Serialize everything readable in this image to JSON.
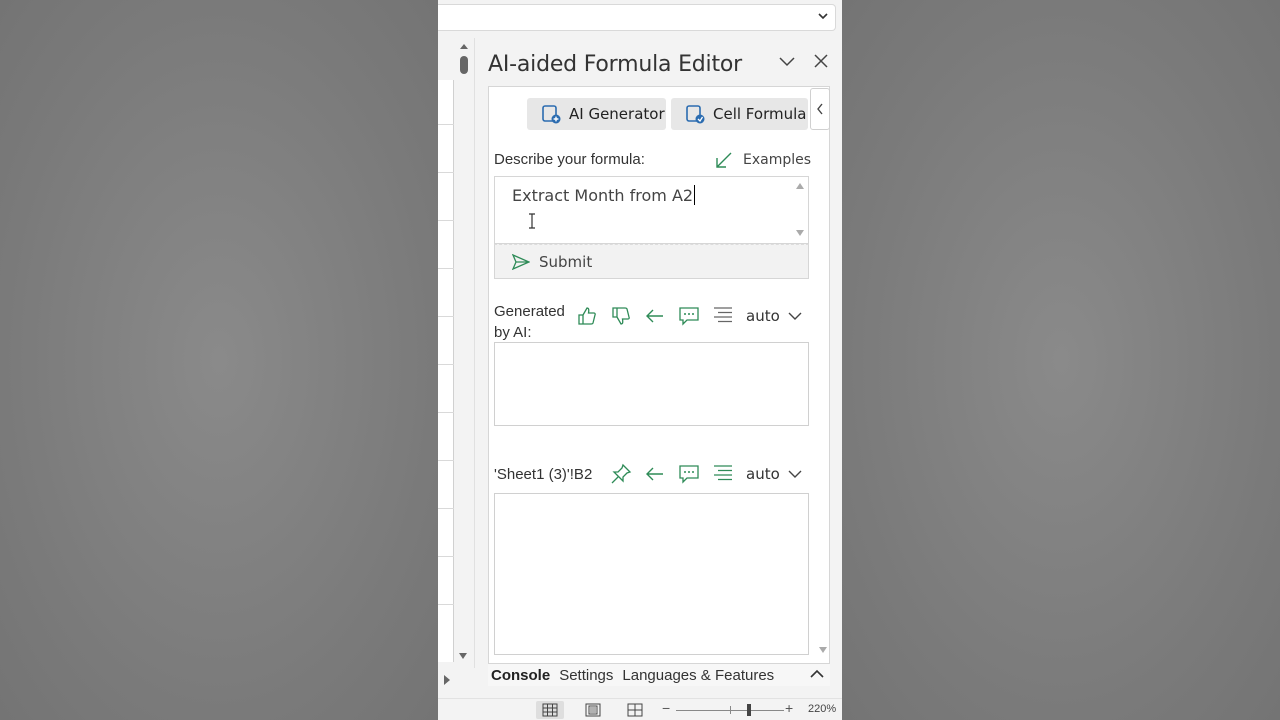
{
  "pane": {
    "title": "AI-aided Formula Editor"
  },
  "tabs": {
    "ai_generator": "AI Generator",
    "cell_formula": "Cell Formula"
  },
  "describe": {
    "label": "Describe your formula:",
    "examples_label": "Examples",
    "input_value": "Extract Month from A2",
    "submit_label": "Submit"
  },
  "generated": {
    "label": "Generated by AI:",
    "mode": "auto",
    "output_value": ""
  },
  "cell": {
    "reference": "'Sheet1 (3)'!B2",
    "mode": "auto",
    "formula_value": ""
  },
  "bottom_tabs": [
    "Console",
    "Settings",
    "Languages & Features"
  ],
  "status": {
    "zoom": "220%"
  },
  "colors": {
    "accent_green": "#2e8b57",
    "accent_blue": "#2b6cb0"
  }
}
